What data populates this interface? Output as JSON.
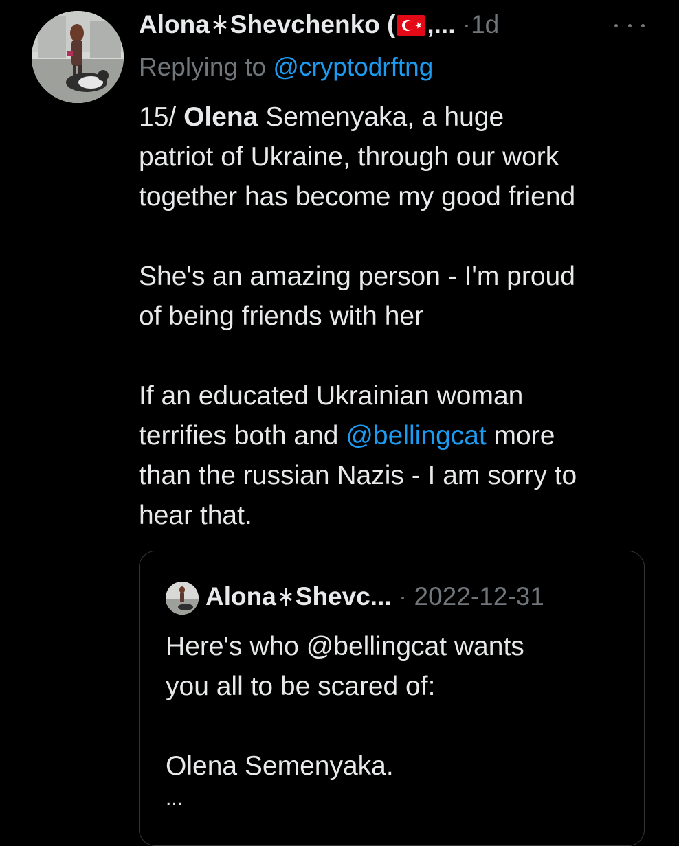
{
  "tweet": {
    "author_name": "Alona",
    "author_name_2": "Shevchenko (",
    "author_name_trunc": ",...",
    "separator": "·",
    "timestamp": "1d",
    "more_label": "···",
    "replying_prefix": "Replying to ",
    "replying_handle": "@cryptodrftng",
    "lines": [
      {
        "prefix": "15/ ",
        "bold": "Olena",
        "rest": " Semenyaka, a huge"
      },
      {
        "text": "patriot of Ukraine, through our work"
      },
      {
        "text": "together has become my good friend"
      },
      {
        "text": "She's an amazing person - I'm proud"
      },
      {
        "text": "of being friends with her"
      },
      {
        "text": "If an educated Ukrainian woman"
      },
      {
        "prefix": "terrifies both and ",
        "mention": "@bellingcat",
        "rest": " more"
      },
      {
        "text": "than the russian Nazis - I am sorry to"
      },
      {
        "text": "hear that."
      }
    ]
  },
  "quoted_tweet": {
    "author_name": "Alona",
    "author_name_2": "Shevc...",
    "separator": "·",
    "date": "2022-12-31",
    "lines": [
      "Here's who @bellingcat wants",
      "you all to be scared of:",
      "Olena Semenyaka."
    ],
    "ellipsis": "..."
  },
  "icons": {
    "rune": "wolfsangel-icon",
    "flag": "turkey-flag-icon",
    "more": "more-options-icon"
  },
  "colors": {
    "background": "#000000",
    "text": "#e7e9ea",
    "muted": "#71767b",
    "link": "#1d9bf0",
    "flag_red": "#e30a17",
    "quote_border": "#333639"
  }
}
